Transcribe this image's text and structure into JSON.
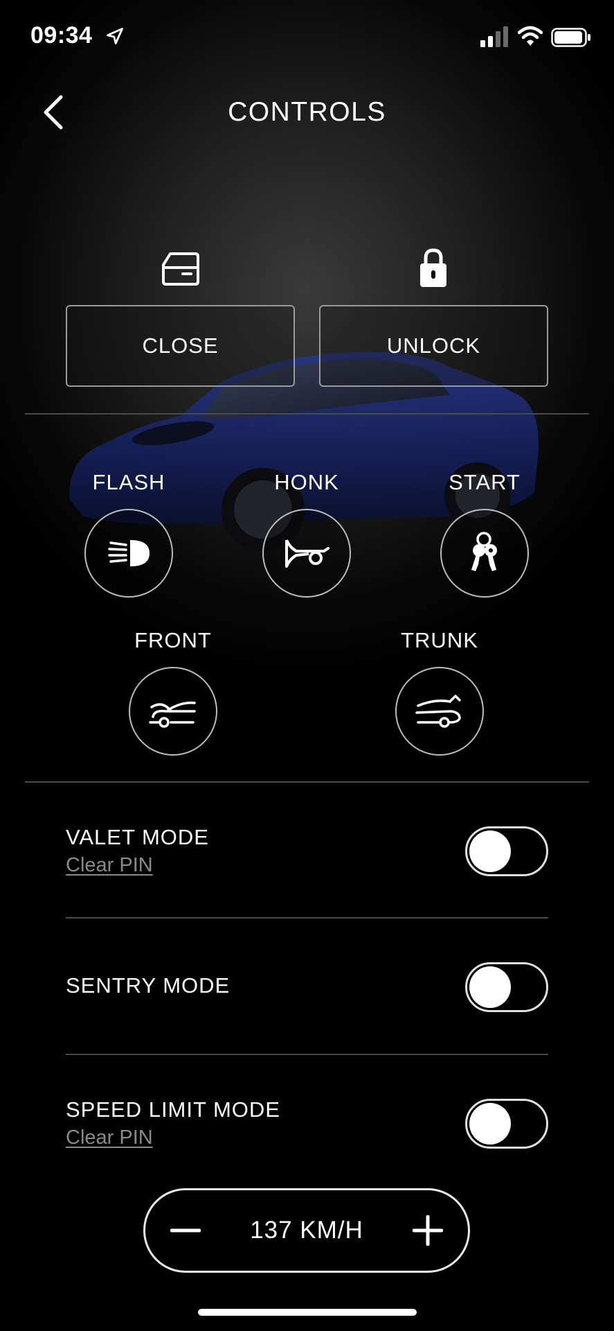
{
  "status_bar": {
    "time": "09:34"
  },
  "header": {
    "title": "CONTROLS"
  },
  "primary_actions": {
    "close_label": "CLOSE",
    "unlock_label": "UNLOCK"
  },
  "quick_controls": {
    "flash_label": "FLASH",
    "honk_label": "HONK",
    "start_label": "START",
    "front_label": "FRONT",
    "trunk_label": "TRUNK"
  },
  "settings": {
    "valet": {
      "title": "VALET MODE",
      "sub": "Clear PIN",
      "enabled": false
    },
    "sentry": {
      "title": "SENTRY MODE",
      "enabled": false
    },
    "speed_limit": {
      "title": "SPEED LIMIT MODE",
      "sub": "Clear PIN",
      "enabled": false
    }
  },
  "speed_limit_value": "137 KM/H",
  "colors": {
    "background": "#000000",
    "car": "#1a2a6b",
    "border": "#9a9a9a"
  }
}
